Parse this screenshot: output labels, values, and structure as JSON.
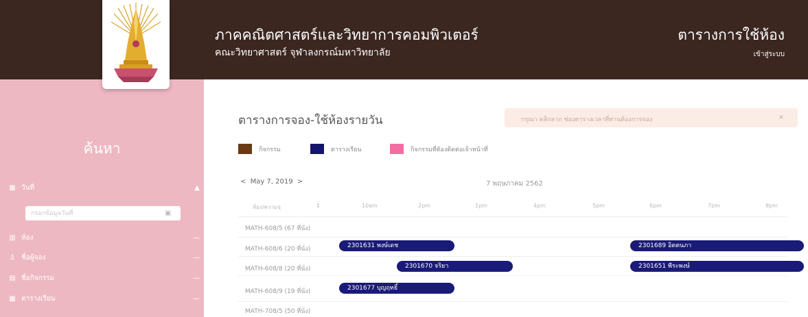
{
  "header": {
    "title": "ภาคคณิตศาสตร์และวิทยาการคอมพิวเตอร์",
    "subtitle": "คณะวิทยาศาสตร์ จุฬาลงกรณ์มหาวิทยาลัย",
    "right_title": "ตารางการใช้ห้อง",
    "login": "เข้าสู่ระบบ"
  },
  "sidebar": {
    "title": "ค้นหา",
    "search_placeholder": "กรอกข้อมูลวันที่",
    "items": [
      {
        "icon": "calendar-icon",
        "label": "วันที่",
        "tail": "▲"
      },
      {
        "icon": "room-icon",
        "label": "ห้อง",
        "tail": "—"
      },
      {
        "icon": "person-icon",
        "label": "ชื่อผู้จอง",
        "tail": "—"
      },
      {
        "icon": "activity-icon",
        "label": "ชื่อกิจกรรม",
        "tail": "—"
      },
      {
        "icon": "schedule-icon",
        "label": "ตารางเรียน",
        "tail": "—"
      }
    ]
  },
  "main": {
    "title": "ตารางการจอง-ใช้ห้องรายวัน",
    "alert": "กรุณา คลิกลาก ช่องตารางเวลาที่ท่านต้องการจอง",
    "alert_close": "×",
    "legend": [
      {
        "label": "กิจกรรม",
        "color": "#6b3a12"
      },
      {
        "label": "ตารางเรียน",
        "color": "#14146e"
      },
      {
        "label": "กิจกรรมที่ต้องติดต่อเจ้าหน้าที่",
        "color": "#f26ea2"
      }
    ],
    "date_prev": "<",
    "date_label": "May 7, 2019",
    "date_next": ">",
    "thai_date": "7 พฤษภาคม 2562",
    "room_column": "ห้อง/ความจุ",
    "sort_icon": "↕",
    "ticks": [
      "10am",
      "2pm",
      "1pm",
      "4pm",
      "5pm",
      "6pm",
      "7pm",
      "8pm"
    ],
    "rooms": [
      "MATH-608/5 (67 ที่นั่ง)",
      "MATH-608/6 (20 ที่นั่ง)",
      "MATH-608/8 (20 ที่นั่ง)",
      "MATH-608/9 (19 ที่นั่ง)",
      "MATH-708/5 (50 ที่นั่ง)"
    ],
    "events": [
      {
        "label": "2301631 พงษ์เดช",
        "room": 1
      },
      {
        "label": "2301689 อิตตนภา",
        "room": 1
      },
      {
        "label": "2301670 จริยา",
        "room": 2
      },
      {
        "label": "2301651 พีระพงษ์",
        "room": 2
      },
      {
        "label": "2301677 บุญฤทธิ์",
        "room": 3
      }
    ]
  },
  "colors": {
    "header_bg": "#3b2620",
    "sidebar_bg": "#eeb8c2",
    "event_bg": "#1a1a78",
    "alert_bg": "#fcece6"
  }
}
